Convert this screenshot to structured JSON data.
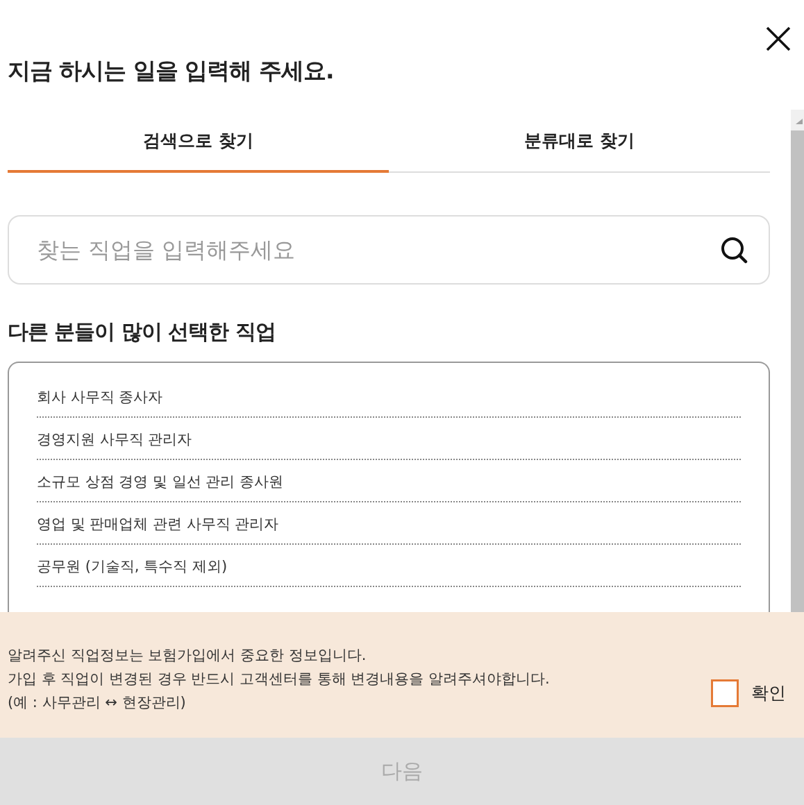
{
  "title": "지금 하시는 일을 입력해 주세요.",
  "tabs": [
    {
      "label": "검색으로 찾기",
      "selected": true
    },
    {
      "label": "분류대로 찾기",
      "selected": false
    }
  ],
  "search": {
    "placeholder": "찾는 직업을 입력해주세요"
  },
  "popular": {
    "heading": "다른 분들이 많이 선택한 직업",
    "items": [
      "회사 사무직 종사자",
      "경영지원 사무직 관리자",
      "소규모 상점 경영 및 일선 관리 종사원",
      "영업 및 판매업체 관련 사무직 관리자",
      "공무원 (기술직, 특수직 제외)"
    ]
  },
  "notice": {
    "lines": [
      "알려주신 직업정보는 보험가입에서 중요한 정보입니다.",
      "가입 후 직업이 변경된 경우 반드시 고객센터를 통해 변경내용을 알려주셔야합니다.",
      "(예 : 사무관리 ↔ 현장관리)"
    ],
    "confirm": {
      "label": "확인",
      "checked": false
    }
  },
  "next_button": {
    "label": "다음",
    "disabled": true
  }
}
